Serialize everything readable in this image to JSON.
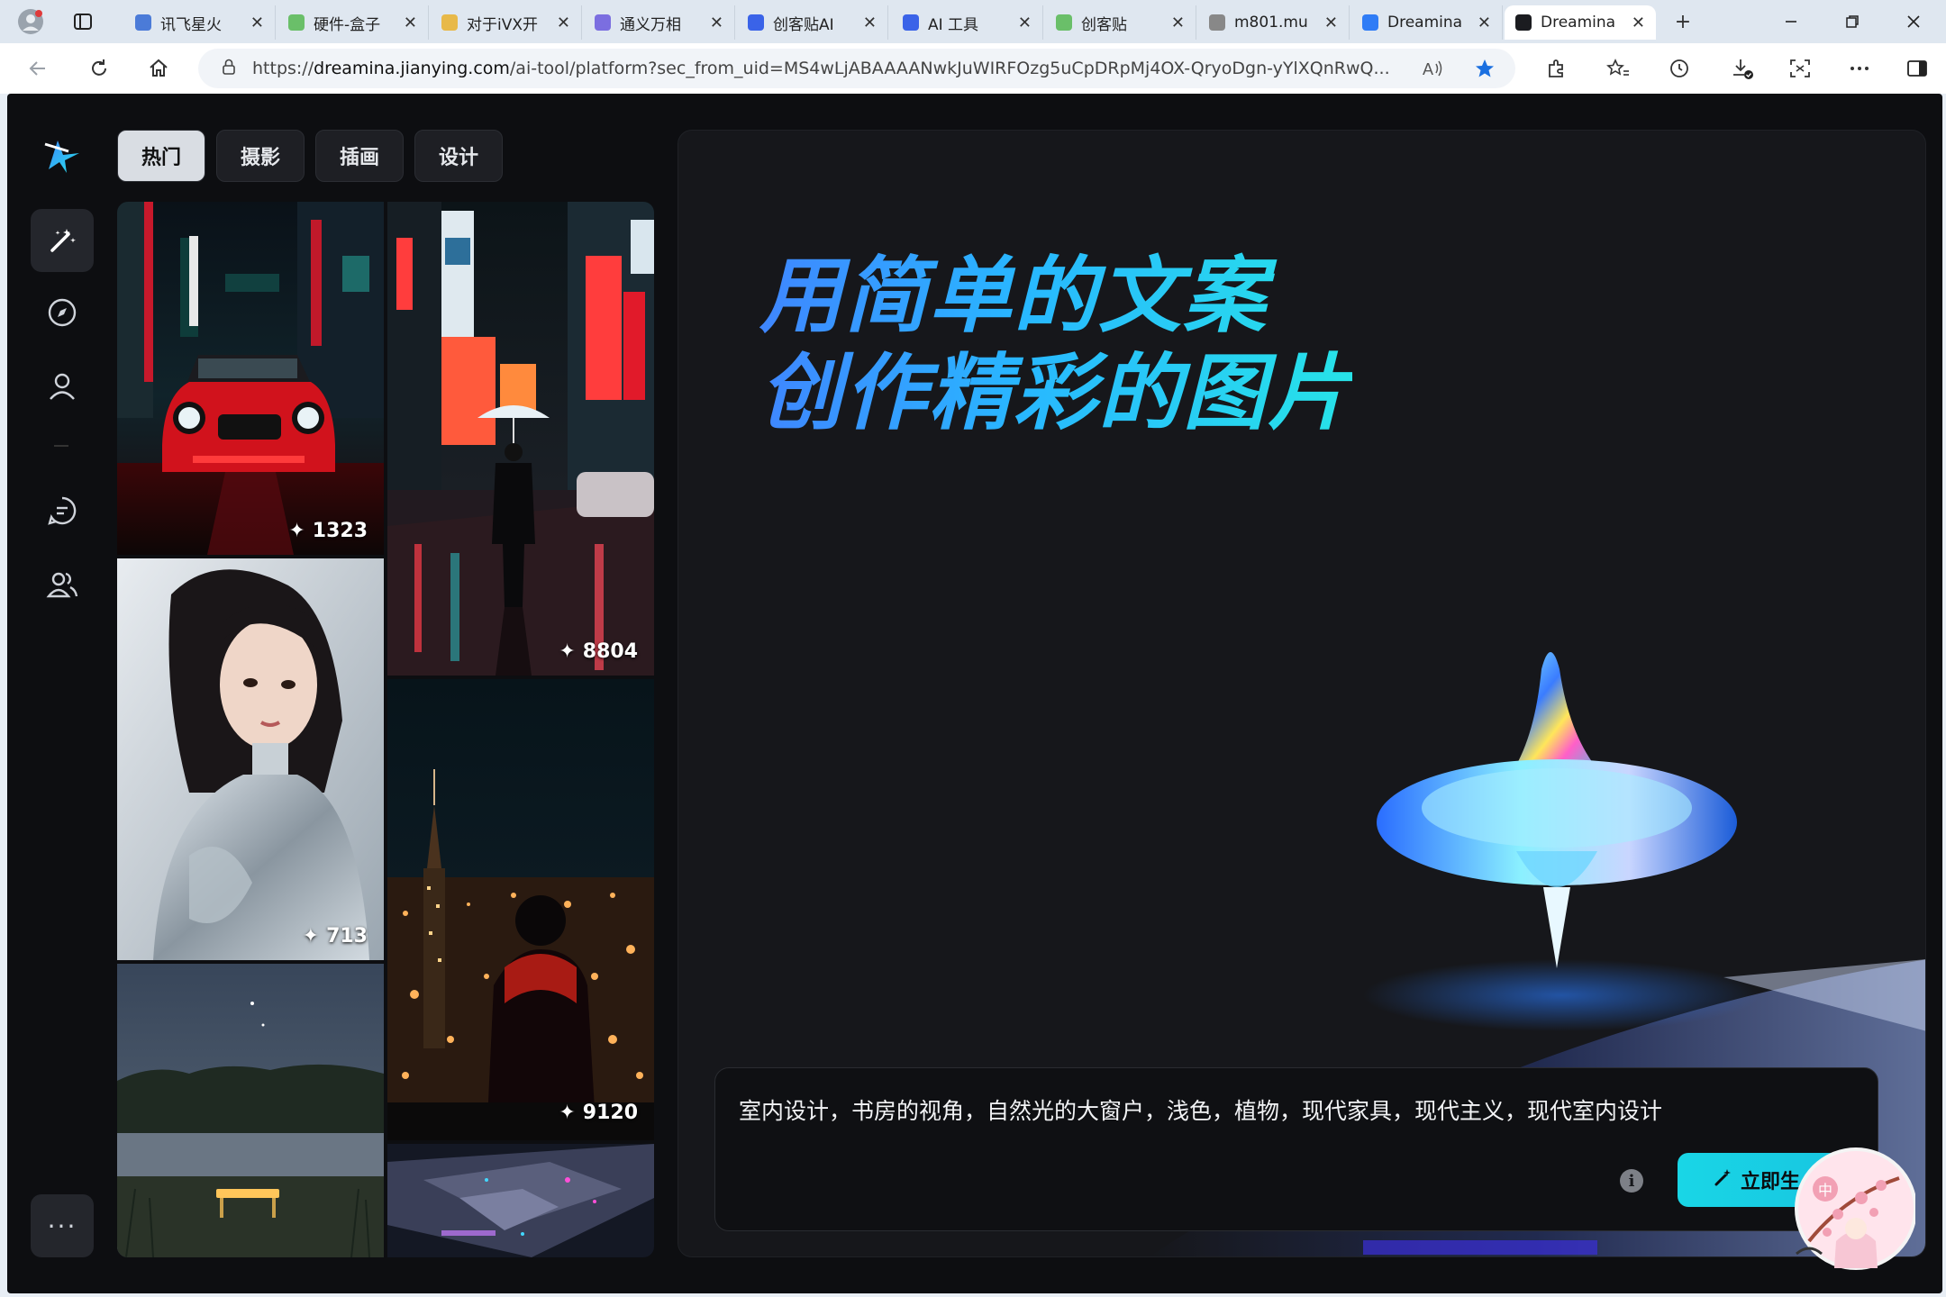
{
  "browser": {
    "tabs": [
      {
        "title": "讯飞星火",
        "color": "#4b7bd8"
      },
      {
        "title": "硬件-盒子",
        "color": "#6abf69"
      },
      {
        "title": "对于iVX开",
        "color": "#e8b949"
      },
      {
        "title": "通义万相",
        "color": "#7b6ee0"
      },
      {
        "title": "创客贴AI",
        "color": "#3a63e8"
      },
      {
        "title": "AI 工具",
        "color": "#3a63e8"
      },
      {
        "title": "创客贴",
        "color": "#6abf69"
      },
      {
        "title": "m801.mu",
        "color": "#888888"
      },
      {
        "title": "Dreamina",
        "color": "#2f7cf6"
      },
      {
        "title": "Dreamina",
        "color": "#1b1c20"
      }
    ],
    "url_prefix": "https://",
    "url_host": "dreamina.jianying.com",
    "url_rest": "/ai-tool/platform?sec_from_uid=MS4wLjABAAAANwkJuWIRFOzg5uCpDRpMj4OX-QryoDgn-yYlXQnRwQ...",
    "tab_close": "✕",
    "new_tab": "+"
  },
  "categories": [
    "热门",
    "摄影",
    "插画",
    "设计"
  ],
  "gallery": {
    "counts": {
      "car": "1323",
      "rain": "8804",
      "girl": "713",
      "city": "9120"
    }
  },
  "hero": {
    "headline_line1": "用简单的文案",
    "headline_line2": "创作精彩的图片"
  },
  "prompt": {
    "text": "室内设计，书房的视角，自然光的大窗户，浅色，植物，现代家具，现代主义，现代室内设计",
    "info_icon": "i",
    "generate_label": "立即生"
  },
  "sidebar": {
    "more_label": "···"
  },
  "ime": {
    "label": "中"
  },
  "colors": {
    "accent": "#19d6e6",
    "bg": "#0d0e11",
    "panel": "#16171b"
  }
}
